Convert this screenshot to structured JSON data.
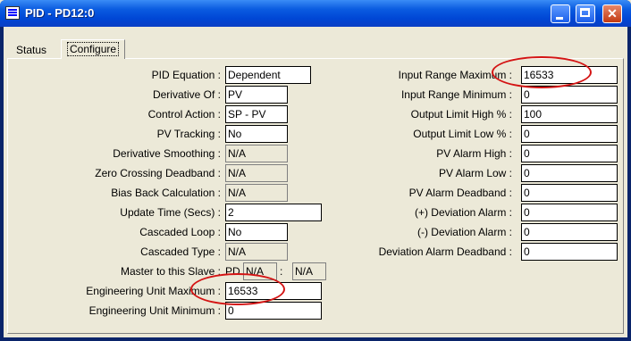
{
  "window": {
    "title": "PID - PD12:0"
  },
  "tabs": [
    {
      "label": "Status"
    },
    {
      "label": "Configure"
    }
  ],
  "left": [
    {
      "label": "PID Equation :",
      "value": "Dependent"
    },
    {
      "label": "Derivative Of :",
      "value": "PV"
    },
    {
      "label": "Control Action :",
      "value": "SP - PV"
    },
    {
      "label": "PV Tracking :",
      "value": "No"
    },
    {
      "label": "Derivative Smoothing :",
      "value": "N/A"
    },
    {
      "label": "Zero Crossing Deadband :",
      "value": "N/A"
    },
    {
      "label": "Bias Back Calculation :",
      "value": "N/A"
    },
    {
      "label": "Update Time (Secs) :",
      "value": "2"
    },
    {
      "label": "Cascaded Loop :",
      "value": "No"
    },
    {
      "label": "Cascaded Type :",
      "value": "N/A"
    },
    {
      "label": "Master to this Slave :",
      "value_prefix": "PD",
      "value": "N/A",
      "value2": "N/A"
    },
    {
      "label": "Engineering Unit Maximum :",
      "value": "16533"
    },
    {
      "label": "Engineering Unit Minimum :",
      "value": "0"
    }
  ],
  "right": [
    {
      "label": "Input Range Maximum :",
      "value": "16533"
    },
    {
      "label": "Input Range Minimum :",
      "value": "0"
    },
    {
      "label": "Output Limit High % :",
      "value": "100"
    },
    {
      "label": "Output Limit Low % :",
      "value": "0"
    },
    {
      "label": "PV Alarm High :",
      "value": "0"
    },
    {
      "label": "PV Alarm Low :",
      "value": "0"
    },
    {
      "label": "PV Alarm Deadband :",
      "value": "0"
    },
    {
      "label": "(+) Deviation Alarm :",
      "value": "0"
    },
    {
      "label": "(-) Deviation Alarm :",
      "value": "0"
    },
    {
      "label": "Deviation Alarm Deadband :",
      "value": "0"
    }
  ],
  "colors": {
    "highlight_oval": "#D41414",
    "title_bar": "#0046D5",
    "dialog_bg": "#ECE9D8"
  }
}
